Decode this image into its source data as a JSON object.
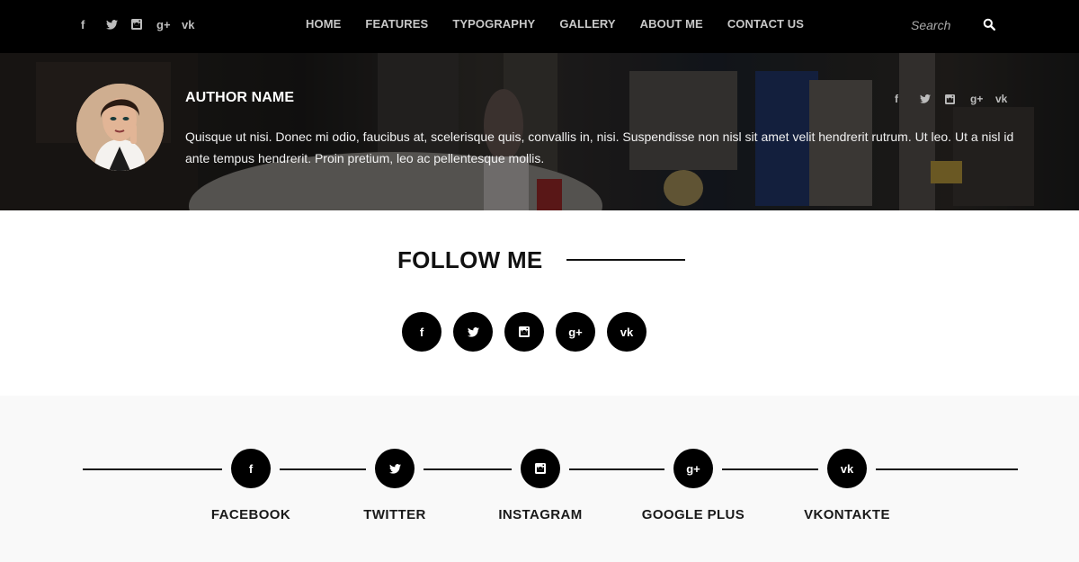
{
  "navbar": {
    "social": [
      {
        "icon": "facebook-icon",
        "glyph": "f"
      },
      {
        "icon": "twitter-icon",
        "glyph": ""
      },
      {
        "icon": "instagram-icon",
        "glyph": ""
      },
      {
        "icon": "google-plus-icon",
        "glyph": "g+"
      },
      {
        "icon": "vk-icon",
        "glyph": "vk"
      }
    ],
    "menu": [
      "HOME",
      "FEATURES",
      "TYPOGRAPHY",
      "GALLERY",
      "ABOUT ME",
      "CONTACT US"
    ],
    "search": {
      "placeholder": "Search",
      "button_icon": "search-icon"
    }
  },
  "author": {
    "name": "AUTHOR NAME",
    "bio": "Quisque ut nisi. Donec mi odio, faucibus at, scelerisque quis, convallis in, nisi. Suspendisse non nisl sit amet velit hendrerit rutrum. Ut leo. Ut a nisl id ante tempus hendrerit. Proin pretium, leo ac pellentesque mollis.",
    "social": [
      {
        "icon": "facebook-icon",
        "glyph": "f"
      },
      {
        "icon": "twitter-icon",
        "glyph": ""
      },
      {
        "icon": "instagram-icon",
        "glyph": ""
      },
      {
        "icon": "google-plus-icon",
        "glyph": "g+"
      },
      {
        "icon": "vk-icon",
        "glyph": "vk"
      }
    ]
  },
  "follow": {
    "title": "FOLLOW ME",
    "icons": [
      {
        "icon": "facebook-icon",
        "glyph": "f"
      },
      {
        "icon": "twitter-icon",
        "glyph": ""
      },
      {
        "icon": "instagram-icon",
        "glyph": ""
      },
      {
        "icon": "google-plus-icon",
        "glyph": "g+"
      },
      {
        "icon": "vk-icon",
        "glyph": "vk"
      }
    ]
  },
  "networks": [
    {
      "label": "FACEBOOK",
      "icon": "facebook-icon",
      "glyph": "f"
    },
    {
      "label": "TWITTER",
      "icon": "twitter-icon",
      "glyph": ""
    },
    {
      "label": "INSTAGRAM",
      "icon": "instagram-icon",
      "glyph": ""
    },
    {
      "label": "GOOGLE PLUS",
      "icon": "google-plus-icon",
      "glyph": "g+"
    },
    {
      "label": "VKONTAKTE",
      "icon": "vk-icon",
      "glyph": "vk"
    }
  ],
  "colors": {
    "navbar": "#000000",
    "accent": "#000000",
    "band": "#f9f9f9"
  }
}
